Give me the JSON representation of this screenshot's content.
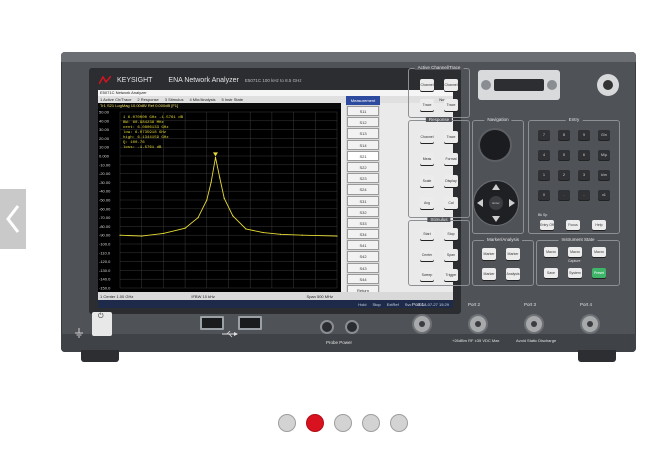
{
  "colors": {
    "accent": "#d9121f",
    "trace": "#e6db35",
    "screen_bg": "#000000"
  },
  "carousel": {
    "slide_count": 5,
    "active_index": 1,
    "prev_icon": "chevron-left-icon"
  },
  "instrument": {
    "brand": "KEYSIGHT",
    "model_title": "ENA Network Analyzer",
    "model_sub": "E5071C  100 kHz to 8.5 GHz",
    "screen": {
      "title": "E5071C Network Analyzer",
      "menu": [
        "1 Active Ch/Trace",
        "2 Response",
        "3 Stimulus",
        "4 Mkr/Analysis",
        "5 Instr State"
      ],
      "menu_right": "Norm",
      "trace_line": "Tr1 S21 LogMag 10.00dB/ Ref 0.000dB [F1]",
      "marker_readout": [
        "1  6.070000 GHz  -1.5761 dB",
        "BW:  60.984238 MHz",
        "cent:  6.0806133 GHz",
        "low:  6.0735918 GHz",
        "high:  6.1344159 GHz",
        "Q:  100.76",
        "loss:  -1.5761 dB"
      ],
      "y_ticks": [
        "50.00",
        "40.00",
        "30.00",
        "20.00",
        "10.00",
        "0.000",
        "-10.00",
        "-20.00",
        "-30.00",
        "-40.00",
        "-50.00",
        "-60.00",
        "-70.00",
        "-80.00",
        "-90.00",
        "-100.0",
        "-110.0",
        "-120.0",
        "-130.0",
        "-140.0",
        "-150.0"
      ],
      "softkeys_title": "Measurement",
      "softkeys": [
        "S11",
        "S12",
        "S13",
        "S14",
        "S21",
        "S22",
        "S23",
        "S24",
        "S31",
        "S32",
        "S33",
        "S34",
        "S41",
        "S42",
        "S43",
        "S44",
        "Return"
      ],
      "status_start": "1 Center 1.00 GHz",
      "status_ifbw": "IFBW 10 kHz",
      "status_span": "Span 500 MHz",
      "status_bottom": [
        "Hold",
        "Stop",
        "ExtRef",
        "Svc",
        "2018-07-27 15:29"
      ]
    },
    "sections": {
      "active_channel": {
        "title": "Active Channel/Trace",
        "keys": [
          "Channel Prev",
          "Channel Next",
          "Trace Prev",
          "Trace Next"
        ]
      },
      "response": {
        "title": "Response",
        "keys": [
          "Channel Max",
          "Trace Max",
          "Meas",
          "Format",
          "Scale",
          "Display",
          "Avg",
          "Cal"
        ]
      },
      "navigation": {
        "title": "Navigation",
        "center_label": "Enter"
      },
      "entry": {
        "title": "Entry",
        "keys": [
          "7",
          "8",
          "9",
          "G/n",
          "4",
          "5",
          "6",
          "M/μ",
          "1",
          "2",
          "3",
          "k/m",
          "0",
          ".",
          "-",
          "x1"
        ],
        "backspace_label": "Bk Sp",
        "keys2": [
          "Entry Off",
          "Focus",
          "Help"
        ]
      },
      "stimulus": {
        "title": "Stimulus",
        "keys": [
          "Start",
          "Stop",
          "Center",
          "Span",
          "Sweep Setup",
          "Trigger"
        ]
      },
      "marker_analysis": {
        "title": "Marker/Analysis",
        "keys": [
          "Marker",
          "Marker Search",
          "Marker Fctn",
          "Analysis"
        ]
      },
      "instrument_state": {
        "title": "Instrument State",
        "keys": [
          "Macro Setup",
          "Macro Run",
          "Macro Break",
          "Save Recall",
          "System",
          "Preset"
        ],
        "sub_label": "Capture"
      }
    },
    "ports": [
      "Port 1",
      "Port 2",
      "Port 3",
      "Port 4"
    ],
    "probe_label": "Probe Power",
    "rf_warning": "+26dBm RF ±35 VDC Max",
    "esd_warning": "Avoid Static Discharge",
    "power_icon": "power-icon",
    "usb_icon": "usb-icon",
    "ground_icon": "ground-icon"
  },
  "chart_data": {
    "type": "line",
    "title": "Tr1 S21 LogMag 10.00dB/ Ref 0.000dB [F1]",
    "xlabel": "",
    "ylabel": "",
    "ylim": [
      -150,
      50
    ],
    "xlim": [
      5.85,
      6.35
    ],
    "x": [
      5.85,
      5.9,
      5.95,
      6.0,
      6.03,
      6.05,
      6.06,
      6.07,
      6.08,
      6.09,
      6.11,
      6.14,
      6.18,
      6.22,
      6.27,
      6.35
    ],
    "series": [
      {
        "values": [
          -90,
          -91,
          -88,
          -82,
          -70,
          -50,
          -30,
          -1.6,
          -25,
          -48,
          -68,
          -83,
          -87,
          -89,
          -90,
          -91
        ]
      }
    ]
  }
}
